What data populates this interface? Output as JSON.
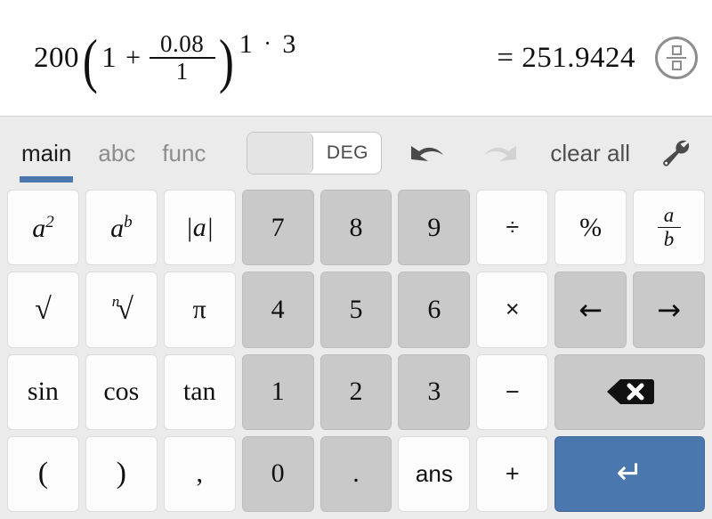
{
  "expression": {
    "coefficient": "200",
    "open_paren": "(",
    "base_term": "1",
    "plus": "+",
    "fraction_numerator": "0.08",
    "fraction_denominator": "1",
    "close_paren": ")",
    "exponent_left": "1",
    "exponent_operator": "·",
    "exponent_right": "3",
    "result": "= 251.9424",
    "toggle_icon": "fraction-decimal-icon"
  },
  "toolbar": {
    "tabs": [
      {
        "label": "main",
        "active": true
      },
      {
        "label": "abc",
        "active": false
      },
      {
        "label": "func",
        "active": false
      }
    ],
    "angle_toggle": {
      "value": "DEG",
      "knob_position": "left"
    },
    "undo_icon": "undo-icon",
    "redo_icon": "redo-icon",
    "clear_all_label": "clear all",
    "settings_icon": "wrench-icon"
  },
  "keys": {
    "row1": [
      {
        "name": "square",
        "label": "a2",
        "style": "white",
        "kind": "sup",
        "base": "a",
        "sup": "2"
      },
      {
        "name": "power",
        "label": "ab",
        "style": "white",
        "kind": "sup",
        "base": "a",
        "sup": "b"
      },
      {
        "name": "absolute-value",
        "label": "|a|",
        "style": "white",
        "kind": "math-italic"
      },
      {
        "name": "digit-7",
        "label": "7",
        "style": "gray",
        "kind": "math"
      },
      {
        "name": "digit-8",
        "label": "8",
        "style": "gray",
        "kind": "math"
      },
      {
        "name": "digit-9",
        "label": "9",
        "style": "gray",
        "kind": "math"
      },
      {
        "name": "divide",
        "label": "÷",
        "style": "white",
        "kind": "op"
      },
      {
        "name": "percent",
        "label": "%",
        "style": "white",
        "kind": "math"
      },
      {
        "name": "fraction",
        "label": "a/b",
        "style": "white",
        "kind": "fraction",
        "numerator": "a",
        "denominator": "b"
      }
    ],
    "row2": [
      {
        "name": "square-root",
        "label": "√",
        "style": "white",
        "kind": "radical"
      },
      {
        "name": "nth-root",
        "label": "n√",
        "style": "white",
        "kind": "nth-root",
        "index": "n"
      },
      {
        "name": "pi",
        "label": "π",
        "style": "white",
        "kind": "math"
      },
      {
        "name": "digit-4",
        "label": "4",
        "style": "gray",
        "kind": "math"
      },
      {
        "name": "digit-5",
        "label": "5",
        "style": "gray",
        "kind": "math"
      },
      {
        "name": "digit-6",
        "label": "6",
        "style": "gray",
        "kind": "math"
      },
      {
        "name": "multiply",
        "label": "×",
        "style": "white",
        "kind": "op"
      },
      {
        "name": "cursor-left",
        "label": "←",
        "style": "gray",
        "kind": "arrow"
      },
      {
        "name": "cursor-right",
        "label": "→",
        "style": "gray",
        "kind": "arrow"
      }
    ],
    "row3": [
      {
        "name": "sin",
        "label": "sin",
        "style": "white",
        "kind": "math"
      },
      {
        "name": "cos",
        "label": "cos",
        "style": "white",
        "kind": "math"
      },
      {
        "name": "tan",
        "label": "tan",
        "style": "white",
        "kind": "math"
      },
      {
        "name": "digit-1",
        "label": "1",
        "style": "gray",
        "kind": "math"
      },
      {
        "name": "digit-2",
        "label": "2",
        "style": "gray",
        "kind": "math"
      },
      {
        "name": "digit-3",
        "label": "3",
        "style": "gray",
        "kind": "math"
      },
      {
        "name": "minus",
        "label": "−",
        "style": "white",
        "kind": "op"
      },
      {
        "name": "backspace",
        "label": "backspace-icon",
        "style": "gray",
        "kind": "backspace",
        "span": 2
      }
    ],
    "row4": [
      {
        "name": "open-parenthesis",
        "label": "(",
        "style": "white",
        "kind": "math"
      },
      {
        "name": "close-parenthesis",
        "label": ")",
        "style": "white",
        "kind": "math"
      },
      {
        "name": "comma",
        "label": ",",
        "style": "white",
        "kind": "math"
      },
      {
        "name": "digit-0",
        "label": "0",
        "style": "gray",
        "kind": "math"
      },
      {
        "name": "decimal-point",
        "label": ".",
        "style": "gray",
        "kind": "math"
      },
      {
        "name": "answer",
        "label": "ans",
        "style": "white",
        "kind": "sans"
      },
      {
        "name": "plus",
        "label": "+",
        "style": "white",
        "kind": "op"
      },
      {
        "name": "enter",
        "label": "↵",
        "style": "blue",
        "kind": "enter",
        "span": 2
      }
    ]
  },
  "colors": {
    "accent_blue": "#4a77ad",
    "keypad_background": "#ebebeb",
    "gray_key": "#c9c9c9",
    "white_key": "#fdfdfd"
  }
}
